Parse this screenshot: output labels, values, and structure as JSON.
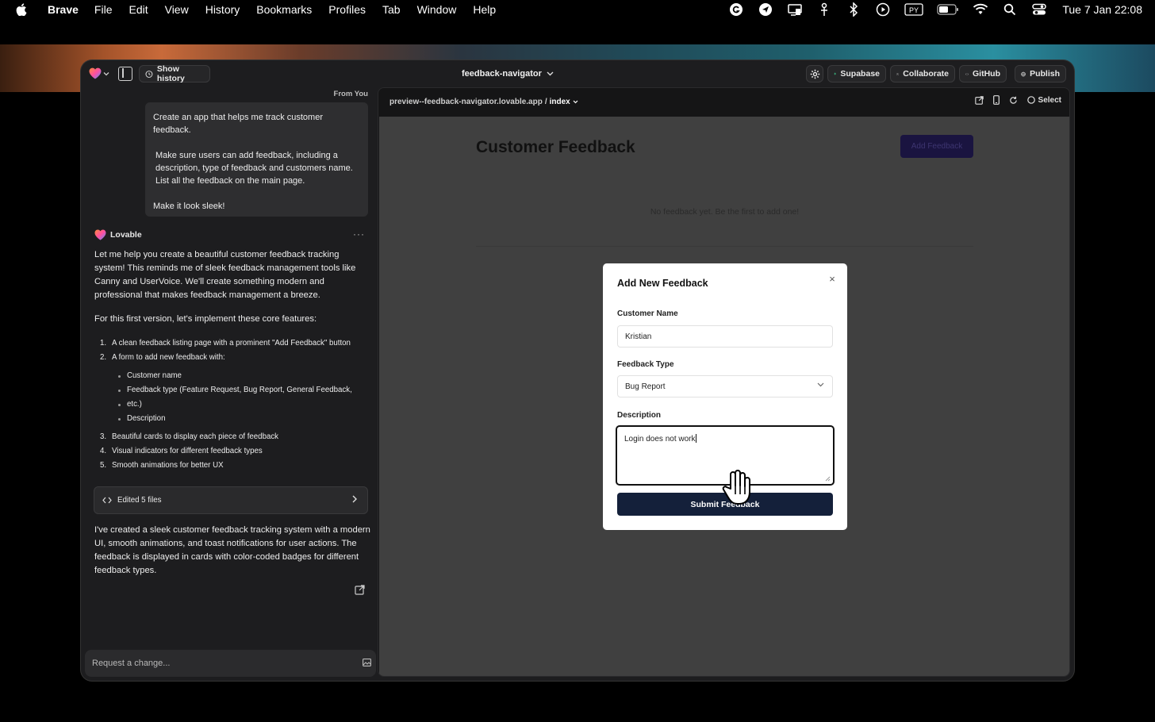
{
  "menubar": {
    "app_name": "Brave",
    "items": [
      "File",
      "Edit",
      "View",
      "History",
      "Bookmarks",
      "Profiles",
      "Tab",
      "Window",
      "Help"
    ],
    "status_icons": [
      "grammarly-icon",
      "navigation-icon",
      "display-icon",
      "accessibility-icon",
      "bluetooth-icon",
      "play-icon",
      "python-icon",
      "battery-icon",
      "wifi-icon",
      "spotlight-icon",
      "control-center-icon"
    ],
    "python_badge": "PY",
    "clock": "Tue 7 Jan  22:08"
  },
  "topbar": {
    "show_history": "Show history",
    "project_name": "feedback-navigator",
    "supabase": "Supabase",
    "collaborate": "Collaborate",
    "github": "GitHub",
    "publish": "Publish"
  },
  "chat": {
    "from_you": "From You",
    "user_message": [
      "Create an app that helps me track customer feedback.",
      "Make sure users can add feedback, including a description, type of feedback and customers name. List all the feedback on the main page.",
      "Make it look sleek!"
    ],
    "bot_name": "Lovable",
    "more": "···",
    "intro": "Let me help you create a beautiful customer feedback tracking system! This reminds me of sleek feedback management tools like Canny and UserVoice. We'll create something modern and professional that makes feedback management a breeze.",
    "features_intro": "For this first version, let's implement these core features:",
    "features": [
      "A clean feedback listing page with a prominent \"Add Feedback\" button",
      "A form to add new feedback with:",
      "Beautiful cards to display each piece of feedback",
      "Visual indicators for different feedback types",
      "Smooth animations for better UX"
    ],
    "sub_features": [
      "Customer name",
      "Feedback type (Feature Request, Bug Report, General Feedback,",
      "etc.)",
      "Description"
    ],
    "edited_files": "Edited 5 files",
    "summary": "I've created a sleek customer feedback tracking system with a modern UI, smooth animations, and toast notifications for user actions. The feedback is displayed in cards with color-coded badges for different feedback types.",
    "request_placeholder": "Request a change..."
  },
  "preview": {
    "url": "preview--feedback-navigator.lovable.app",
    "page": "index",
    "select": "Select",
    "title": "Customer Feedback",
    "add_button": "Add Feedback",
    "empty_text": "No feedback yet. Be the first to add one!"
  },
  "modal": {
    "title": "Add New Feedback",
    "close": "×",
    "customer_name_label": "Customer Name",
    "customer_name_value": "Kristian",
    "feedback_type_label": "Feedback Type",
    "feedback_type_value": "Bug Report",
    "description_label": "Description",
    "description_value": "Login does not work",
    "submit": "Submit Feedback"
  }
}
